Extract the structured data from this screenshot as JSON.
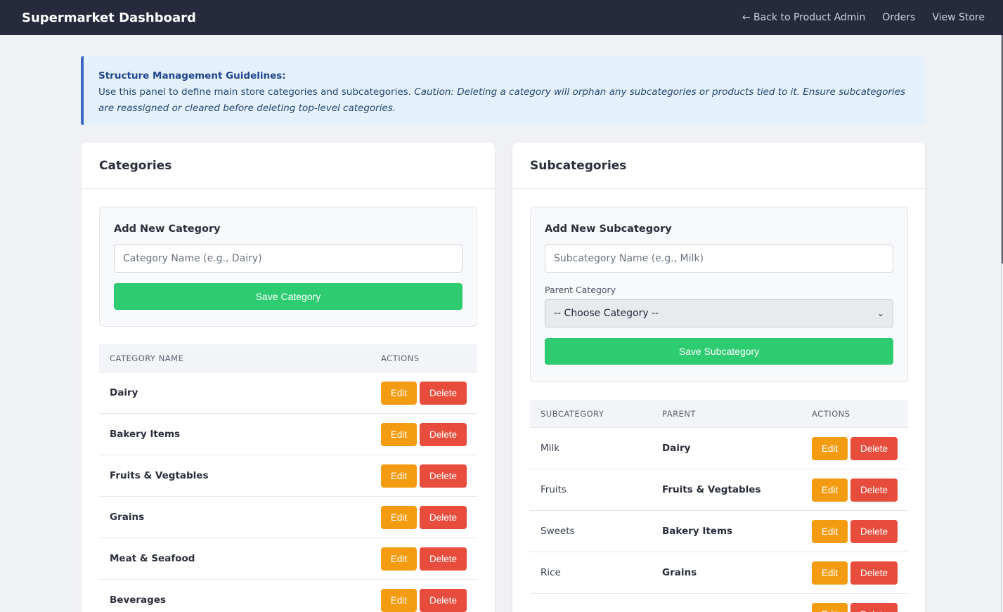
{
  "header": {
    "brand": "Supermarket Dashboard",
    "nav": [
      {
        "label": "← Back to Product Admin"
      },
      {
        "label": "Orders"
      },
      {
        "label": "View Store"
      }
    ]
  },
  "guidelines": {
    "title": "Structure Management Guidelines:",
    "text": "Use this panel to define main store categories and subcategories.",
    "caution": "Caution: Deleting a category will orphan any subcategories or products tied to it. Ensure subcategories are reassigned or cleared before deleting top-level categories."
  },
  "categories_panel": {
    "title": "Categories",
    "form": {
      "title": "Add New Category",
      "placeholder": "Category Name (e.g., Dairy)",
      "save_label": "Save Category"
    },
    "table": {
      "headers": [
        "CATEGORY NAME",
        "ACTIONS"
      ],
      "rows": [
        {
          "name": "Dairy"
        },
        {
          "name": "Bakery Items"
        },
        {
          "name": "Fruits & Vegtables"
        },
        {
          "name": "Grains"
        },
        {
          "name": "Meat & Seafood"
        },
        {
          "name": "Beverages"
        }
      ]
    }
  },
  "subcategories_panel": {
    "title": "Subcategories",
    "form": {
      "title": "Add New Subcategory",
      "placeholder": "Subcategory Name (e.g., Milk)",
      "parent_label": "Parent Category",
      "parent_selected": "-- Choose Category --",
      "save_label": "Save Subcategory"
    },
    "table": {
      "headers": [
        "SUBCATEGORY",
        "PARENT",
        "ACTIONS"
      ],
      "rows": [
        {
          "name": "Milk",
          "parent": "Dairy"
        },
        {
          "name": "Fruits",
          "parent": "Fruits & Vegtables"
        },
        {
          "name": "Sweets",
          "parent": "Bakery Items"
        },
        {
          "name": "Rice",
          "parent": "Grains"
        },
        {
          "name": "",
          "parent": ""
        }
      ]
    }
  },
  "actions": {
    "edit_label": "Edit",
    "delete_label": "Delete"
  },
  "colors": {
    "topbar": "#272a3d",
    "save": "#2ecc71",
    "edit": "#f39c12",
    "delete": "#e74c3c",
    "guide_bg": "#e4f1fb",
    "guide_border": "#3c66c4"
  }
}
